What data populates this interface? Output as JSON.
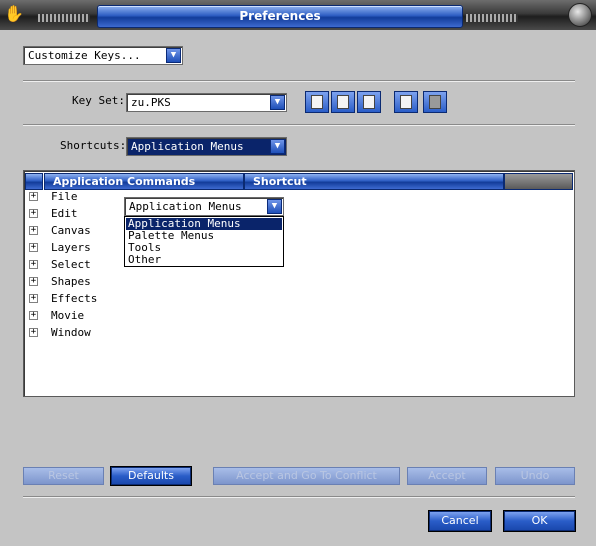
{
  "window": {
    "title": "Preferences"
  },
  "category_select": {
    "value": "Customize Keys..."
  },
  "key_set": {
    "label": "Key Set:",
    "value": "zu.PKS"
  },
  "shortcuts": {
    "label": "Shortcuts:",
    "value": "Application Menus"
  },
  "table": {
    "columns": [
      "Application Commands",
      "Shortcut"
    ],
    "rows": [
      "File",
      "Edit",
      "Canvas",
      "Layers",
      "Select",
      "Shapes",
      "Effects",
      "Movie",
      "Window"
    ]
  },
  "dropdown_popup": {
    "value": "Application Menus",
    "options": [
      "Application Menus",
      "Palette Menus",
      "Tools",
      "Other"
    ],
    "selected_index": 0
  },
  "buttons": {
    "reset": "Reset",
    "defaults": "Defaults",
    "accept_conflict": "Accept and Go To Conflict",
    "accept": "Accept",
    "undo": "Undo",
    "cancel": "Cancel",
    "ok": "OK"
  },
  "icons": [
    "hand-icon",
    "window-orb-icon",
    "new-keyset-icon",
    "duplicate-keyset-icon",
    "rename-keyset-icon",
    "export-keyset-icon",
    "delete-keyset-icon",
    "expand-icon"
  ],
  "colors": {
    "accent_blue": "#2f5fc4",
    "selection": "#0a246a",
    "dialog_bg": "#c4c4c4"
  }
}
